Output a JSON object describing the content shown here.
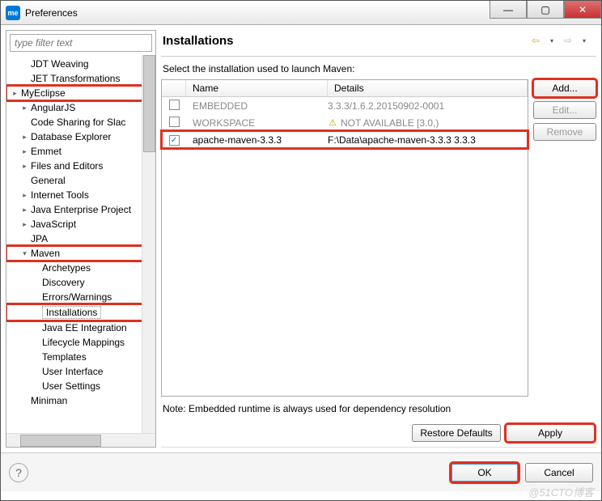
{
  "window": {
    "title": "Preferences",
    "icon_text": "me"
  },
  "filter_placeholder": "type filter text",
  "tree": [
    {
      "label": "JDT Weaving",
      "level": 1
    },
    {
      "label": "JET Transformations",
      "level": 1
    },
    {
      "label": "MyEclipse",
      "level": 0,
      "expander": "▸",
      "redbox": true
    },
    {
      "label": "AngularJS",
      "level": 1,
      "expander": "▸"
    },
    {
      "label": "Code Sharing for Slac",
      "level": 1
    },
    {
      "label": "Database Explorer",
      "level": 1,
      "expander": "▸"
    },
    {
      "label": "Emmet",
      "level": 1,
      "expander": "▸"
    },
    {
      "label": "Files and Editors",
      "level": 1,
      "expander": "▸"
    },
    {
      "label": "General",
      "level": 1
    },
    {
      "label": "Internet Tools",
      "level": 1,
      "expander": "▸"
    },
    {
      "label": "Java Enterprise Project",
      "level": 1,
      "expander": "▸"
    },
    {
      "label": "JavaScript",
      "level": 1,
      "expander": "▸"
    },
    {
      "label": "JPA",
      "level": 1
    },
    {
      "label": "Maven",
      "level": 1,
      "expander": "▾",
      "redbox": true
    },
    {
      "label": "Archetypes",
      "level": 2
    },
    {
      "label": "Discovery",
      "level": 2
    },
    {
      "label": "Errors/Warnings",
      "level": 2
    },
    {
      "label": "Installations",
      "level": 2,
      "selected": true,
      "redbox": true
    },
    {
      "label": "Java EE Integration",
      "level": 2
    },
    {
      "label": "Lifecycle Mappings",
      "level": 2
    },
    {
      "label": "Templates",
      "level": 2
    },
    {
      "label": "User Interface",
      "level": 2
    },
    {
      "label": "User Settings",
      "level": 2
    },
    {
      "label": "Miniman",
      "level": 1
    }
  ],
  "page": {
    "title": "Installations",
    "instruction": "Select the installation used to launch Maven:",
    "columns": {
      "name": "Name",
      "details": "Details"
    },
    "rows": [
      {
        "checked": false,
        "name": "EMBEDDED",
        "details": "3.3.3/1.6.2.20150902-0001",
        "disabled": true
      },
      {
        "checked": false,
        "name": "WORKSPACE",
        "details": "NOT AVAILABLE [3.0,)",
        "disabled": true,
        "warn": true
      },
      {
        "checked": true,
        "name": "apache-maven-3.3.3",
        "details": "F:\\Data\\apache-maven-3.3.3 3.3.3",
        "redbox": true
      }
    ],
    "buttons": {
      "add": "Add...",
      "edit": "Edit...",
      "remove": "Remove"
    },
    "note": "Note: Embedded runtime is always used for dependency resolution",
    "restore": "Restore Defaults",
    "apply": "Apply"
  },
  "footer": {
    "ok": "OK",
    "cancel": "Cancel"
  },
  "watermark": "@51CTO博客"
}
